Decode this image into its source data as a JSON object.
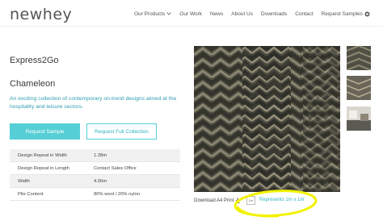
{
  "header": {
    "logo": "newhey",
    "nav": {
      "our_products": "Our Products",
      "our_work": "Our Work",
      "news": "News",
      "about_us": "About Us",
      "downloads": "Downloads",
      "contact": "Contact",
      "request_samples": "Request Samples"
    }
  },
  "product": {
    "name": "Express2Go",
    "collection": "Chameleon",
    "description": "An exciting collection of contemporary on-trend designs aimed at the hospitality and leisure sectors."
  },
  "actions": {
    "request_sample": "Request Sample",
    "request_full_collection": "Request Full Collection"
  },
  "specs": [
    {
      "label": "Design Repeat in Width",
      "value": "1.28m"
    },
    {
      "label": "Design Repeat in Length",
      "value": "Contact Sales Office"
    },
    {
      "label": "Width",
      "value": "4.00m"
    },
    {
      "label": "Pile Content",
      "value": "80% wool / 20% nylon"
    }
  ],
  "image_panel": {
    "download": "Download A4 Print",
    "measure_label": "1m",
    "represents": "Represents 1m x 1m"
  },
  "colors": {
    "accent": "#55cfd5",
    "accent_text": "#2fb3c0",
    "highlight": "#f2f200",
    "carpet_dark": "#3e3e36"
  }
}
